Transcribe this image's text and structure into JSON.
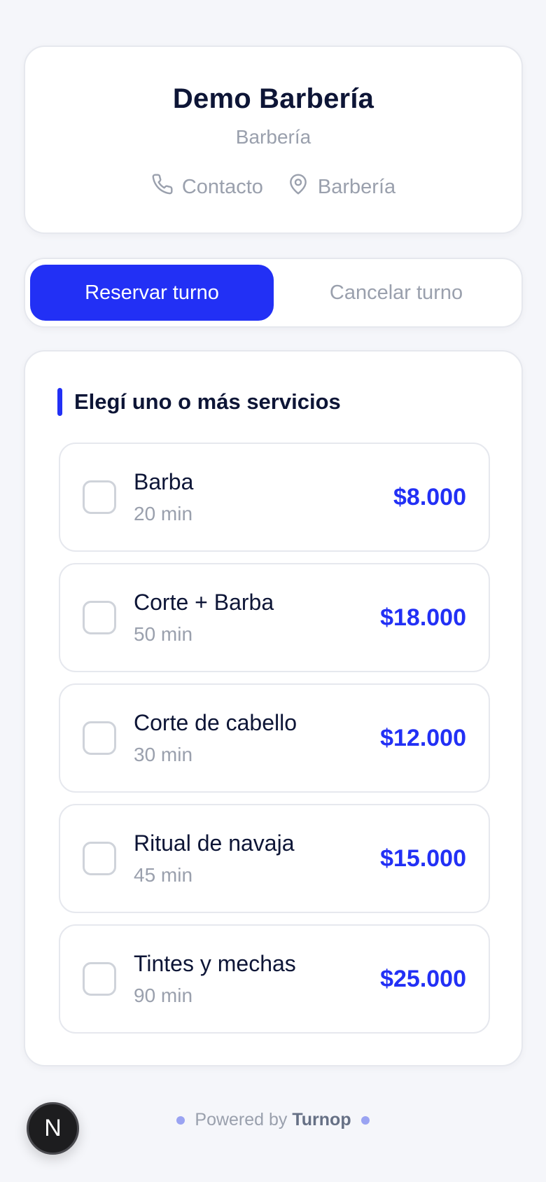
{
  "business": {
    "name": "Demo Barbería",
    "category": "Barbería",
    "contact_label": "Contacto",
    "location_label": "Barbería"
  },
  "tabs": {
    "book_label": "Reservar turno",
    "cancel_label": "Cancelar turno",
    "active": "book"
  },
  "services_section": {
    "title": "Elegí uno o más servicios",
    "items": [
      {
        "name": "Barba",
        "duration": "20 min",
        "price": "$8.000",
        "selected": false
      },
      {
        "name": "Corte + Barba",
        "duration": "50 min",
        "price": "$18.000",
        "selected": false
      },
      {
        "name": "Corte de cabello",
        "duration": "30 min",
        "price": "$12.000",
        "selected": false
      },
      {
        "name": "Ritual de navaja",
        "duration": "45 min",
        "price": "$15.000",
        "selected": false
      },
      {
        "name": "Tintes y mechas",
        "duration": "90 min",
        "price": "$25.000",
        "selected": false
      }
    ]
  },
  "footer": {
    "prefix": "Powered by",
    "brand": "Turnop"
  },
  "dev_badge": {
    "letter": "N"
  },
  "colors": {
    "accent": "#2230f5",
    "background": "#f5f6fa",
    "text_primary": "#0d1536",
    "text_muted": "#9aa0ad"
  }
}
